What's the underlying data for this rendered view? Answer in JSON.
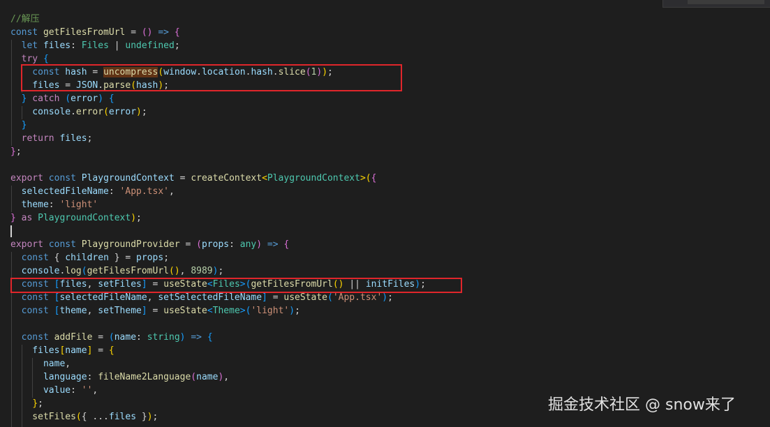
{
  "editor": {
    "lines": [
      [
        {
          "t": "//解压",
          "c": "cm"
        }
      ],
      [
        {
          "t": "const ",
          "c": "kw"
        },
        {
          "t": "getFilesFromUrl",
          "c": "fn"
        },
        {
          "t": " = ",
          "c": "pl"
        },
        {
          "t": "()",
          "c": "br2"
        },
        {
          "t": " => ",
          "c": "kw"
        },
        {
          "t": "{",
          "c": "br2"
        }
      ],
      [
        {
          "t": "  let ",
          "c": "kw"
        },
        {
          "t": "files",
          "c": "var"
        },
        {
          "t": ": ",
          "c": "pl"
        },
        {
          "t": "Files",
          "c": "type"
        },
        {
          "t": " | ",
          "c": "pl"
        },
        {
          "t": "undefined",
          "c": "type"
        },
        {
          "t": ";",
          "c": "pl"
        }
      ],
      [
        {
          "t": "  try ",
          "c": "ctl"
        },
        {
          "t": "{",
          "c": "br3"
        }
      ],
      [
        {
          "t": "    const ",
          "c": "kw"
        },
        {
          "t": "hash",
          "c": "var"
        },
        {
          "t": " = ",
          "c": "pl"
        },
        {
          "t": "uncompress",
          "c": "fn",
          "sel": true
        },
        {
          "t": "(",
          "c": "br1"
        },
        {
          "t": "window",
          "c": "var"
        },
        {
          "t": ".",
          "c": "pl"
        },
        {
          "t": "location",
          "c": "var"
        },
        {
          "t": ".",
          "c": "pl"
        },
        {
          "t": "hash",
          "c": "var"
        },
        {
          "t": ".",
          "c": "pl"
        },
        {
          "t": "slice",
          "c": "fn"
        },
        {
          "t": "(",
          "c": "br2"
        },
        {
          "t": "1",
          "c": "num"
        },
        {
          "t": ")",
          "c": "br2"
        },
        {
          "t": ")",
          "c": "br1"
        },
        {
          "t": ";",
          "c": "pl"
        }
      ],
      [
        {
          "t": "    files",
          "c": "var"
        },
        {
          "t": " = ",
          "c": "pl"
        },
        {
          "t": "JSON",
          "c": "var"
        },
        {
          "t": ".",
          "c": "pl"
        },
        {
          "t": "parse",
          "c": "fn"
        },
        {
          "t": "(",
          "c": "br1"
        },
        {
          "t": "hash",
          "c": "var"
        },
        {
          "t": ")",
          "c": "br1"
        },
        {
          "t": ";",
          "c": "pl"
        }
      ],
      [
        {
          "t": "  ",
          "c": "pl"
        },
        {
          "t": "}",
          "c": "br3"
        },
        {
          "t": " catch ",
          "c": "ctl"
        },
        {
          "t": "(",
          "c": "br3"
        },
        {
          "t": "error",
          "c": "var"
        },
        {
          "t": ")",
          "c": "br3"
        },
        {
          "t": " ",
          "c": "pl"
        },
        {
          "t": "{",
          "c": "br3"
        }
      ],
      [
        {
          "t": "    console",
          "c": "var"
        },
        {
          "t": ".",
          "c": "pl"
        },
        {
          "t": "error",
          "c": "fn"
        },
        {
          "t": "(",
          "c": "br1"
        },
        {
          "t": "error",
          "c": "var"
        },
        {
          "t": ")",
          "c": "br1"
        },
        {
          "t": ";",
          "c": "pl"
        }
      ],
      [
        {
          "t": "  ",
          "c": "pl"
        },
        {
          "t": "}",
          "c": "br3"
        }
      ],
      [
        {
          "t": "  return ",
          "c": "ctl"
        },
        {
          "t": "files",
          "c": "var"
        },
        {
          "t": ";",
          "c": "pl"
        }
      ],
      [
        {
          "t": "}",
          "c": "br2"
        },
        {
          "t": ";",
          "c": "pl"
        }
      ],
      [],
      [
        {
          "t": "export ",
          "c": "ctl"
        },
        {
          "t": "const ",
          "c": "kw"
        },
        {
          "t": "PlaygroundContext",
          "c": "var"
        },
        {
          "t": " = ",
          "c": "pl"
        },
        {
          "t": "createContext",
          "c": "fn"
        },
        {
          "t": "<",
          "c": "br1"
        },
        {
          "t": "PlaygroundContext",
          "c": "type"
        },
        {
          "t": ">",
          "c": "br1"
        },
        {
          "t": "(",
          "c": "br1"
        },
        {
          "t": "{",
          "c": "br2"
        }
      ],
      [
        {
          "t": "  selectedFileName",
          "c": "var"
        },
        {
          "t": ": ",
          "c": "pl"
        },
        {
          "t": "'App.tsx'",
          "c": "str"
        },
        {
          "t": ",",
          "c": "pl"
        }
      ],
      [
        {
          "t": "  theme",
          "c": "var"
        },
        {
          "t": ": ",
          "c": "pl"
        },
        {
          "t": "'light'",
          "c": "str"
        }
      ],
      [
        {
          "t": "}",
          "c": "br2"
        },
        {
          "t": " as ",
          "c": "ctl"
        },
        {
          "t": "PlaygroundContext",
          "c": "type"
        },
        {
          "t": ")",
          "c": "br1"
        },
        {
          "t": ";",
          "c": "pl"
        }
      ],
      [],
      [
        {
          "t": "export ",
          "c": "ctl"
        },
        {
          "t": "const ",
          "c": "kw"
        },
        {
          "t": "PlaygroundProvider",
          "c": "fn"
        },
        {
          "t": " = ",
          "c": "pl"
        },
        {
          "t": "(",
          "c": "br2"
        },
        {
          "t": "props",
          "c": "var"
        },
        {
          "t": ": ",
          "c": "pl"
        },
        {
          "t": "any",
          "c": "type"
        },
        {
          "t": ")",
          "c": "br2"
        },
        {
          "t": " => ",
          "c": "kw"
        },
        {
          "t": "{",
          "c": "br2"
        }
      ],
      [
        {
          "t": "  const ",
          "c": "kw"
        },
        {
          "t": "{ ",
          "c": "pl"
        },
        {
          "t": "children",
          "c": "var"
        },
        {
          "t": " } = ",
          "c": "pl"
        },
        {
          "t": "props",
          "c": "var"
        },
        {
          "t": ";",
          "c": "pl"
        }
      ],
      [
        {
          "t": "  console",
          "c": "var"
        },
        {
          "t": ".",
          "c": "pl"
        },
        {
          "t": "log",
          "c": "fn"
        },
        {
          "t": "(",
          "c": "br3"
        },
        {
          "t": "getFilesFromUrl",
          "c": "fn"
        },
        {
          "t": "()",
          "c": "br1"
        },
        {
          "t": ", ",
          "c": "pl"
        },
        {
          "t": "8989",
          "c": "num"
        },
        {
          "t": ")",
          "c": "br3"
        },
        {
          "t": ";",
          "c": "pl"
        }
      ],
      [
        {
          "t": "  const ",
          "c": "kw"
        },
        {
          "t": "[",
          "c": "br3"
        },
        {
          "t": "files",
          "c": "var"
        },
        {
          "t": ", ",
          "c": "pl"
        },
        {
          "t": "setFiles",
          "c": "var"
        },
        {
          "t": "]",
          "c": "br3"
        },
        {
          "t": " = ",
          "c": "pl"
        },
        {
          "t": "useState",
          "c": "fn"
        },
        {
          "t": "<",
          "c": "br3"
        },
        {
          "t": "Files",
          "c": "type"
        },
        {
          "t": ">",
          "c": "br3"
        },
        {
          "t": "(",
          "c": "br3"
        },
        {
          "t": "getFilesFromUrl",
          "c": "fn"
        },
        {
          "t": "()",
          "c": "br1"
        },
        {
          "t": " || ",
          "c": "pl"
        },
        {
          "t": "initFiles",
          "c": "var"
        },
        {
          "t": ")",
          "c": "br3"
        },
        {
          "t": ";",
          "c": "pl"
        }
      ],
      [
        {
          "t": "  const ",
          "c": "kw"
        },
        {
          "t": "[",
          "c": "br3"
        },
        {
          "t": "selectedFileName",
          "c": "var"
        },
        {
          "t": ", ",
          "c": "pl"
        },
        {
          "t": "setSelectedFileName",
          "c": "var"
        },
        {
          "t": "]",
          "c": "br3"
        },
        {
          "t": " = ",
          "c": "pl"
        },
        {
          "t": "useState",
          "c": "fn"
        },
        {
          "t": "(",
          "c": "br3"
        },
        {
          "t": "'App.tsx'",
          "c": "str"
        },
        {
          "t": ")",
          "c": "br3"
        },
        {
          "t": ";",
          "c": "pl"
        }
      ],
      [
        {
          "t": "  const ",
          "c": "kw"
        },
        {
          "t": "[",
          "c": "br3"
        },
        {
          "t": "theme",
          "c": "var"
        },
        {
          "t": ", ",
          "c": "pl"
        },
        {
          "t": "setTheme",
          "c": "var"
        },
        {
          "t": "]",
          "c": "br3"
        },
        {
          "t": " = ",
          "c": "pl"
        },
        {
          "t": "useState",
          "c": "fn"
        },
        {
          "t": "<",
          "c": "br3"
        },
        {
          "t": "Theme",
          "c": "type"
        },
        {
          "t": ">",
          "c": "br3"
        },
        {
          "t": "(",
          "c": "br3"
        },
        {
          "t": "'light'",
          "c": "str"
        },
        {
          "t": ")",
          "c": "br3"
        },
        {
          "t": ";",
          "c": "pl"
        }
      ],
      [],
      [
        {
          "t": "  const ",
          "c": "kw"
        },
        {
          "t": "addFile",
          "c": "fn"
        },
        {
          "t": " = ",
          "c": "pl"
        },
        {
          "t": "(",
          "c": "br3"
        },
        {
          "t": "name",
          "c": "var"
        },
        {
          "t": ": ",
          "c": "pl"
        },
        {
          "t": "string",
          "c": "type"
        },
        {
          "t": ")",
          "c": "br3"
        },
        {
          "t": " => ",
          "c": "kw"
        },
        {
          "t": "{",
          "c": "br3"
        }
      ],
      [
        {
          "t": "    files",
          "c": "var"
        },
        {
          "t": "[",
          "c": "br1"
        },
        {
          "t": "name",
          "c": "var"
        },
        {
          "t": "]",
          "c": "br1"
        },
        {
          "t": " = ",
          "c": "pl"
        },
        {
          "t": "{",
          "c": "br1"
        }
      ],
      [
        {
          "t": "      name",
          "c": "var"
        },
        {
          "t": ",",
          "c": "pl"
        }
      ],
      [
        {
          "t": "      language",
          "c": "var"
        },
        {
          "t": ": ",
          "c": "pl"
        },
        {
          "t": "fileName2Language",
          "c": "fn"
        },
        {
          "t": "(",
          "c": "br2"
        },
        {
          "t": "name",
          "c": "var"
        },
        {
          "t": ")",
          "c": "br2"
        },
        {
          "t": ",",
          "c": "pl"
        }
      ],
      [
        {
          "t": "      value",
          "c": "var"
        },
        {
          "t": ": ",
          "c": "pl"
        },
        {
          "t": "''",
          "c": "str"
        },
        {
          "t": ",",
          "c": "pl"
        }
      ],
      [
        {
          "t": "    ",
          "c": "pl"
        },
        {
          "t": "}",
          "c": "br1"
        },
        {
          "t": ";",
          "c": "pl"
        }
      ],
      [
        {
          "t": "    setFiles",
          "c": "fn"
        },
        {
          "t": "(",
          "c": "br1"
        },
        {
          "t": "{ ...",
          "c": "pl"
        },
        {
          "t": "files",
          "c": "var"
        },
        {
          "t": " }",
          "c": "pl"
        },
        {
          "t": ")",
          "c": "br1"
        },
        {
          "t": ";",
          "c": "pl"
        }
      ]
    ]
  },
  "watermark": "掘金技术社区 @ snow来了"
}
